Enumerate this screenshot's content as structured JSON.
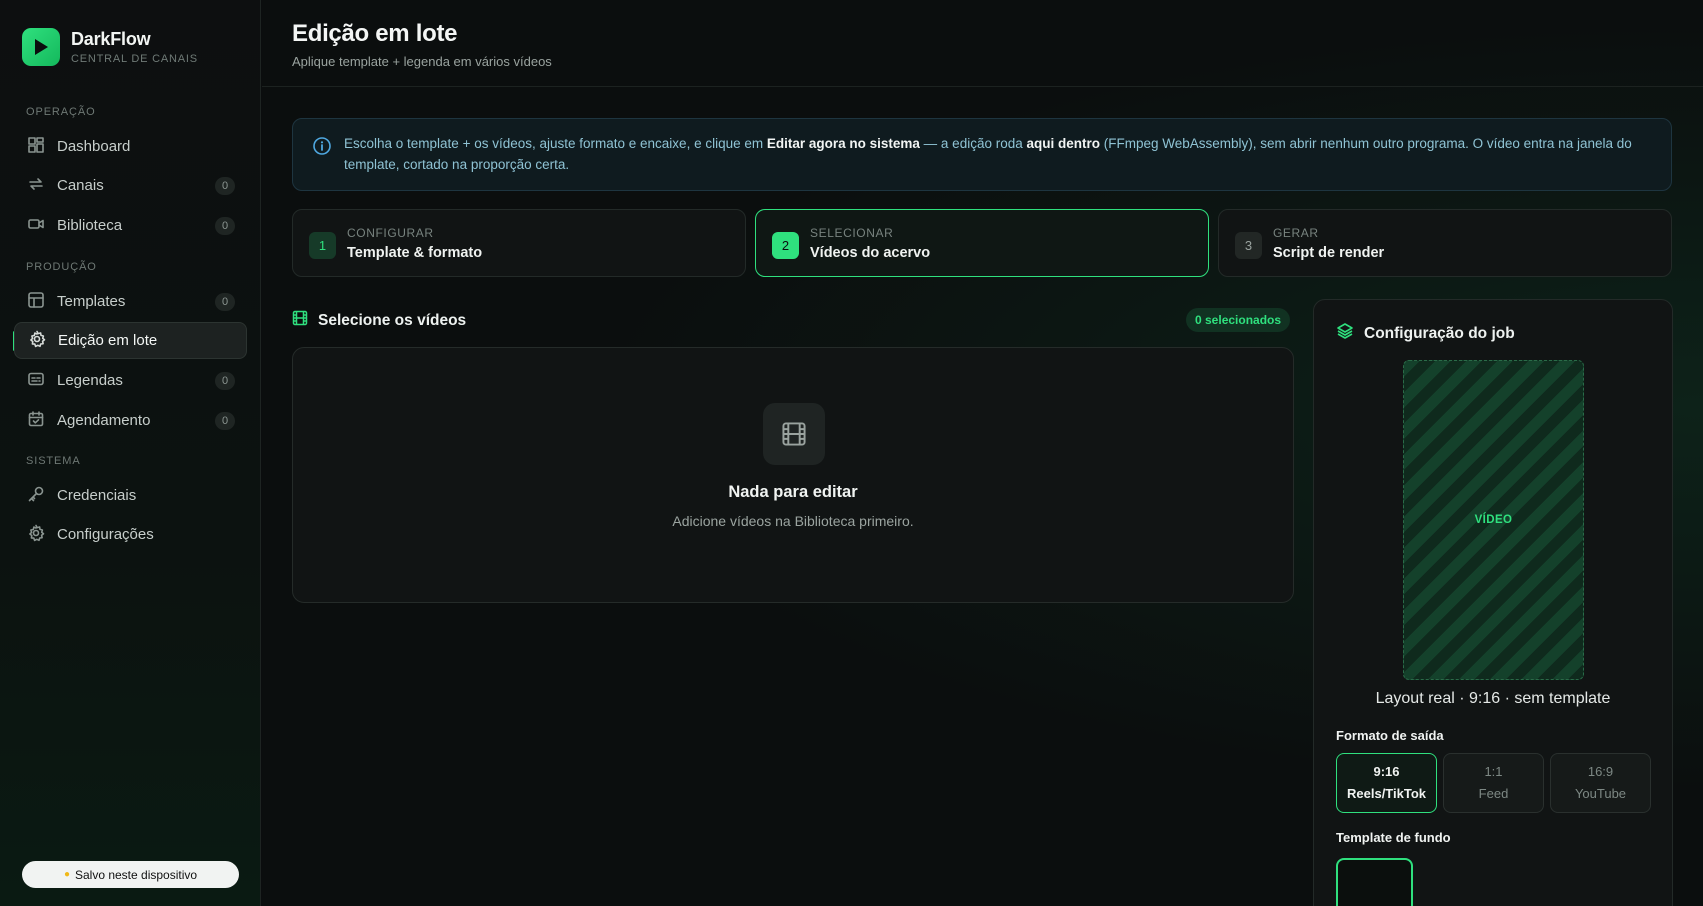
{
  "brand": {
    "name": "DarkFlow",
    "subtitle": "CENTRAL DE CANAIS"
  },
  "sidebar": {
    "sections": {
      "operacao": "OPERAÇÃO",
      "producao": "PRODUÇÃO",
      "sistema": "SISTEMA"
    },
    "items": [
      {
        "label": "Dashboard",
        "icon": "dashboard-icon"
      },
      {
        "label": "Canais",
        "icon": "repeat-icon",
        "count": "0"
      },
      {
        "label": "Biblioteca",
        "icon": "video-camera-icon",
        "count": "0"
      },
      {
        "label": "Templates",
        "icon": "layout-icon",
        "count": "0"
      },
      {
        "label": "Edição em lote",
        "icon": "gear-icon",
        "active": true
      },
      {
        "label": "Legendas",
        "icon": "captions-icon",
        "count": "0"
      },
      {
        "label": "Agendamento",
        "icon": "calendar-icon",
        "count": "0"
      },
      {
        "label": "Credenciais",
        "icon": "key-icon"
      },
      {
        "label": "Configurações",
        "icon": "gear-icon"
      }
    ],
    "saved": "Salvo neste dispositivo"
  },
  "header": {
    "title": "Edição em lote",
    "subtitle": "Aplique template + legenda em vários vídeos"
  },
  "info": {
    "t1": "Escolha o template + os vídeos, ajuste formato e encaixe, e clique em ",
    "b1": "Editar agora no sistema",
    "t2": " — a edição roda ",
    "b2": "aqui dentro",
    "t3": " (FFmpeg WebAssembly), sem abrir nenhum outro programa. O vídeo entra na janela do template, cortado na proporção certa."
  },
  "steps": [
    {
      "num": "1",
      "kicker": "CONFIGURAR",
      "title": "Template & formato"
    },
    {
      "num": "2",
      "kicker": "SELECIONAR",
      "title": "Vídeos do acervo",
      "active": true
    },
    {
      "num": "3",
      "kicker": "GERAR",
      "title": "Script de render"
    }
  ],
  "selection": {
    "title": "Selecione os vídeos",
    "badge": "0 selecionados",
    "empty_title": "Nada para editar",
    "empty_sub": "Adicione vídeos na Biblioteca primeiro."
  },
  "job": {
    "title": "Configuração do job",
    "preview_label": "VÍDEO",
    "layout_caption": "Layout real · 9:16 · sem template",
    "format_label": "Formato de saída",
    "formats": [
      {
        "ratio": "9:16",
        "name": "Reels/TikTok",
        "active": true
      },
      {
        "ratio": "1:1",
        "name": "Feed"
      },
      {
        "ratio": "16:9",
        "name": "YouTube"
      }
    ],
    "background_label": "Template de fundo"
  },
  "colors": {
    "accent": "#2fe07e",
    "info_text": "#8fc3d4",
    "background": "#0b0d0e"
  }
}
